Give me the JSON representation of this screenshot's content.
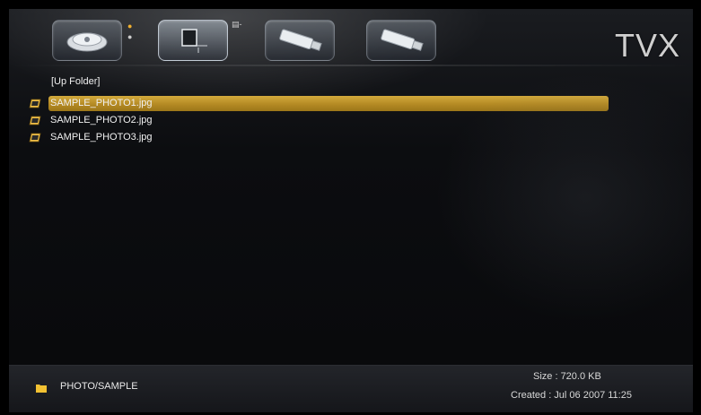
{
  "header": {
    "logo": "TVX",
    "devices": [
      {
        "icon": "hard-drive-icon",
        "active": false
      },
      {
        "icon": "network-pc-icon",
        "active": true
      },
      {
        "icon": "usb-drive-icon",
        "active": false
      },
      {
        "icon": "usb-drive-icon",
        "active": false
      }
    ]
  },
  "browser": {
    "up_folder": "[Up Folder]",
    "files": [
      {
        "name": "SAMPLE_PHOTO1.jpg",
        "icon": "photo-file-icon",
        "selected": true
      },
      {
        "name": "SAMPLE_PHOTO2.jpg",
        "icon": "photo-file-icon",
        "selected": false
      },
      {
        "name": "SAMPLE_PHOTO3.jpg",
        "icon": "photo-file-icon",
        "selected": false
      }
    ]
  },
  "footer": {
    "path": "PHOTO/SAMPLE",
    "size": "Size : 720.0 KB",
    "created": "Created : Jul 06  2007  11:25"
  },
  "colors": {
    "highlight": "#c19a2e",
    "folder": "#f2c132",
    "background": "#0c0d10"
  }
}
